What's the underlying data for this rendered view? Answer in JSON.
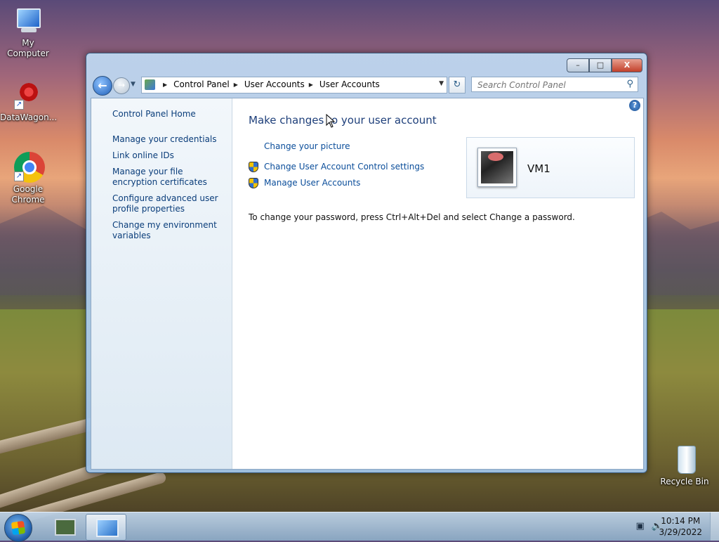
{
  "desktop": {
    "icons": [
      {
        "label": "My Computer"
      },
      {
        "label": "DataWagon..."
      },
      {
        "label": "Google Chrome"
      },
      {
        "label": "Recycle Bin"
      }
    ]
  },
  "window": {
    "buttons": {
      "minimize": "–",
      "maximize": "□",
      "close": "X"
    },
    "address": {
      "crumbs": [
        "Control Panel",
        "User Accounts",
        "User Accounts"
      ]
    },
    "search": {
      "placeholder": "Search Control Panel"
    },
    "left_pane": {
      "home": "Control Panel Home",
      "links": [
        "Manage your credentials",
        "Link online IDs",
        "Manage your file encryption certificates",
        "Configure advanced user profile properties",
        "Change my environment variables"
      ]
    },
    "main": {
      "heading": "Make changes to your user account",
      "links": [
        "Change your picture",
        "Change User Account Control settings",
        "Manage User Accounts"
      ],
      "user_name": "VM1",
      "password_note": "To change your password, press Ctrl+Alt+Del and select Change a password."
    }
  },
  "taskbar": {
    "time": "10:14 PM",
    "date": "3/29/2022"
  },
  "icons": {
    "back": "back-arrow-icon",
    "forward": "forward-arrow-icon",
    "refresh": "refresh-icon",
    "search": "magnifier-icon",
    "help": "help-icon",
    "uac": "uac-shield-icon"
  }
}
